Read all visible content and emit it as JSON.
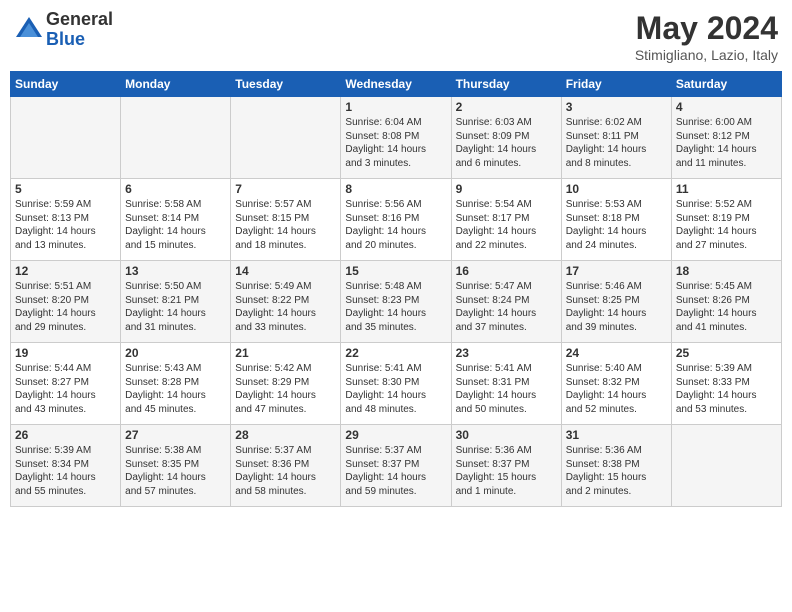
{
  "logo": {
    "general": "General",
    "blue": "Blue"
  },
  "header": {
    "month": "May 2024",
    "location": "Stimigliano, Lazio, Italy"
  },
  "days_of_week": [
    "Sunday",
    "Monday",
    "Tuesday",
    "Wednesday",
    "Thursday",
    "Friday",
    "Saturday"
  ],
  "weeks": [
    [
      {
        "day": "",
        "content": ""
      },
      {
        "day": "",
        "content": ""
      },
      {
        "day": "",
        "content": ""
      },
      {
        "day": "1",
        "content": "Sunrise: 6:04 AM\nSunset: 8:08 PM\nDaylight: 14 hours\nand 3 minutes."
      },
      {
        "day": "2",
        "content": "Sunrise: 6:03 AM\nSunset: 8:09 PM\nDaylight: 14 hours\nand 6 minutes."
      },
      {
        "day": "3",
        "content": "Sunrise: 6:02 AM\nSunset: 8:11 PM\nDaylight: 14 hours\nand 8 minutes."
      },
      {
        "day": "4",
        "content": "Sunrise: 6:00 AM\nSunset: 8:12 PM\nDaylight: 14 hours\nand 11 minutes."
      }
    ],
    [
      {
        "day": "5",
        "content": "Sunrise: 5:59 AM\nSunset: 8:13 PM\nDaylight: 14 hours\nand 13 minutes."
      },
      {
        "day": "6",
        "content": "Sunrise: 5:58 AM\nSunset: 8:14 PM\nDaylight: 14 hours\nand 15 minutes."
      },
      {
        "day": "7",
        "content": "Sunrise: 5:57 AM\nSunset: 8:15 PM\nDaylight: 14 hours\nand 18 minutes."
      },
      {
        "day": "8",
        "content": "Sunrise: 5:56 AM\nSunset: 8:16 PM\nDaylight: 14 hours\nand 20 minutes."
      },
      {
        "day": "9",
        "content": "Sunrise: 5:54 AM\nSunset: 8:17 PM\nDaylight: 14 hours\nand 22 minutes."
      },
      {
        "day": "10",
        "content": "Sunrise: 5:53 AM\nSunset: 8:18 PM\nDaylight: 14 hours\nand 24 minutes."
      },
      {
        "day": "11",
        "content": "Sunrise: 5:52 AM\nSunset: 8:19 PM\nDaylight: 14 hours\nand 27 minutes."
      }
    ],
    [
      {
        "day": "12",
        "content": "Sunrise: 5:51 AM\nSunset: 8:20 PM\nDaylight: 14 hours\nand 29 minutes."
      },
      {
        "day": "13",
        "content": "Sunrise: 5:50 AM\nSunset: 8:21 PM\nDaylight: 14 hours\nand 31 minutes."
      },
      {
        "day": "14",
        "content": "Sunrise: 5:49 AM\nSunset: 8:22 PM\nDaylight: 14 hours\nand 33 minutes."
      },
      {
        "day": "15",
        "content": "Sunrise: 5:48 AM\nSunset: 8:23 PM\nDaylight: 14 hours\nand 35 minutes."
      },
      {
        "day": "16",
        "content": "Sunrise: 5:47 AM\nSunset: 8:24 PM\nDaylight: 14 hours\nand 37 minutes."
      },
      {
        "day": "17",
        "content": "Sunrise: 5:46 AM\nSunset: 8:25 PM\nDaylight: 14 hours\nand 39 minutes."
      },
      {
        "day": "18",
        "content": "Sunrise: 5:45 AM\nSunset: 8:26 PM\nDaylight: 14 hours\nand 41 minutes."
      }
    ],
    [
      {
        "day": "19",
        "content": "Sunrise: 5:44 AM\nSunset: 8:27 PM\nDaylight: 14 hours\nand 43 minutes."
      },
      {
        "day": "20",
        "content": "Sunrise: 5:43 AM\nSunset: 8:28 PM\nDaylight: 14 hours\nand 45 minutes."
      },
      {
        "day": "21",
        "content": "Sunrise: 5:42 AM\nSunset: 8:29 PM\nDaylight: 14 hours\nand 47 minutes."
      },
      {
        "day": "22",
        "content": "Sunrise: 5:41 AM\nSunset: 8:30 PM\nDaylight: 14 hours\nand 48 minutes."
      },
      {
        "day": "23",
        "content": "Sunrise: 5:41 AM\nSunset: 8:31 PM\nDaylight: 14 hours\nand 50 minutes."
      },
      {
        "day": "24",
        "content": "Sunrise: 5:40 AM\nSunset: 8:32 PM\nDaylight: 14 hours\nand 52 minutes."
      },
      {
        "day": "25",
        "content": "Sunrise: 5:39 AM\nSunset: 8:33 PM\nDaylight: 14 hours\nand 53 minutes."
      }
    ],
    [
      {
        "day": "26",
        "content": "Sunrise: 5:39 AM\nSunset: 8:34 PM\nDaylight: 14 hours\nand 55 minutes."
      },
      {
        "day": "27",
        "content": "Sunrise: 5:38 AM\nSunset: 8:35 PM\nDaylight: 14 hours\nand 57 minutes."
      },
      {
        "day": "28",
        "content": "Sunrise: 5:37 AM\nSunset: 8:36 PM\nDaylight: 14 hours\nand 58 minutes."
      },
      {
        "day": "29",
        "content": "Sunrise: 5:37 AM\nSunset: 8:37 PM\nDaylight: 14 hours\nand 59 minutes."
      },
      {
        "day": "30",
        "content": "Sunrise: 5:36 AM\nSunset: 8:37 PM\nDaylight: 15 hours\nand 1 minute."
      },
      {
        "day": "31",
        "content": "Sunrise: 5:36 AM\nSunset: 8:38 PM\nDaylight: 15 hours\nand 2 minutes."
      },
      {
        "day": "",
        "content": ""
      }
    ]
  ]
}
